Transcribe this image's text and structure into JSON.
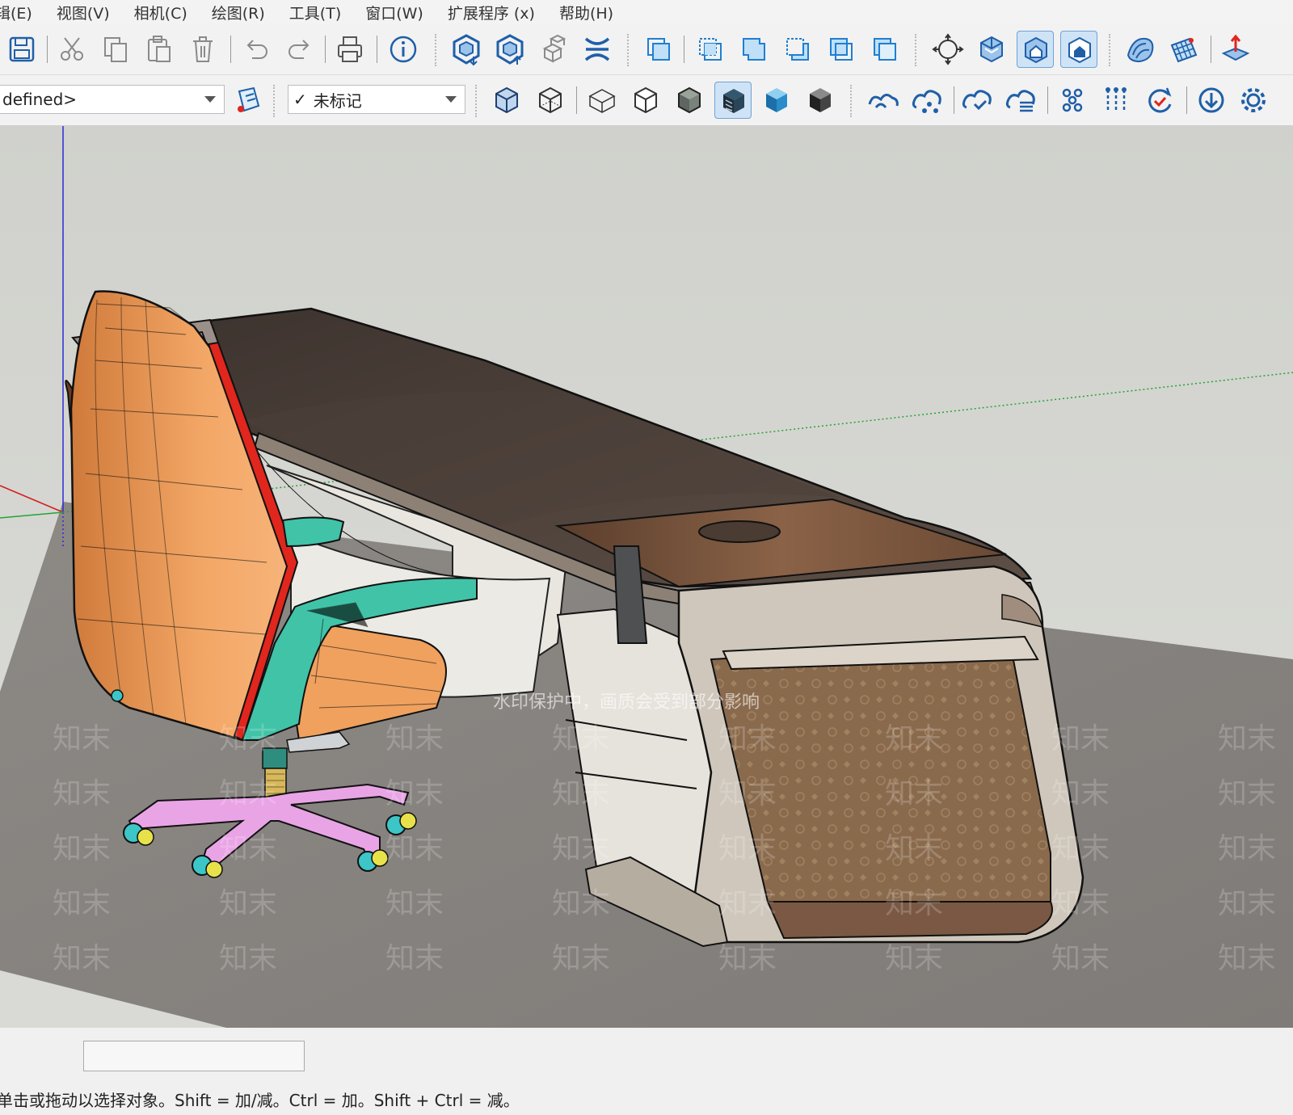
{
  "menu": [
    "辑(E)",
    "视图(V)",
    "相机(C)",
    "绘图(R)",
    "工具(T)",
    "窗口(W)",
    "扩展程序 (x)",
    "帮助(H)"
  ],
  "style_dropdown": "defined>",
  "tag_dropdown": "未标记",
  "tag_check": "✓",
  "status_hint": "单击或拖动以选择对象。Shift = 加/减。Ctrl = 加。Shift + Ctrl = 减。",
  "measurements_value": "",
  "watermark": {
    "brand": "知末",
    "notice": "水印保护中，画质会受到部分影响"
  },
  "colors": {
    "sky": "#d6d7d2",
    "ground": "#8e8b88",
    "desk_top": "#5a4a40",
    "desk_wood": "#7b5a40",
    "desk_frame": "#c9c0b3",
    "leather_panel": "#8a6a4c",
    "chair_shell": "#f2a25f",
    "chair_arm": "#41c3a8",
    "chair_base": "#e9a4e6",
    "accent_red": "#e0261d",
    "active_tool": "#cfe3f7"
  }
}
